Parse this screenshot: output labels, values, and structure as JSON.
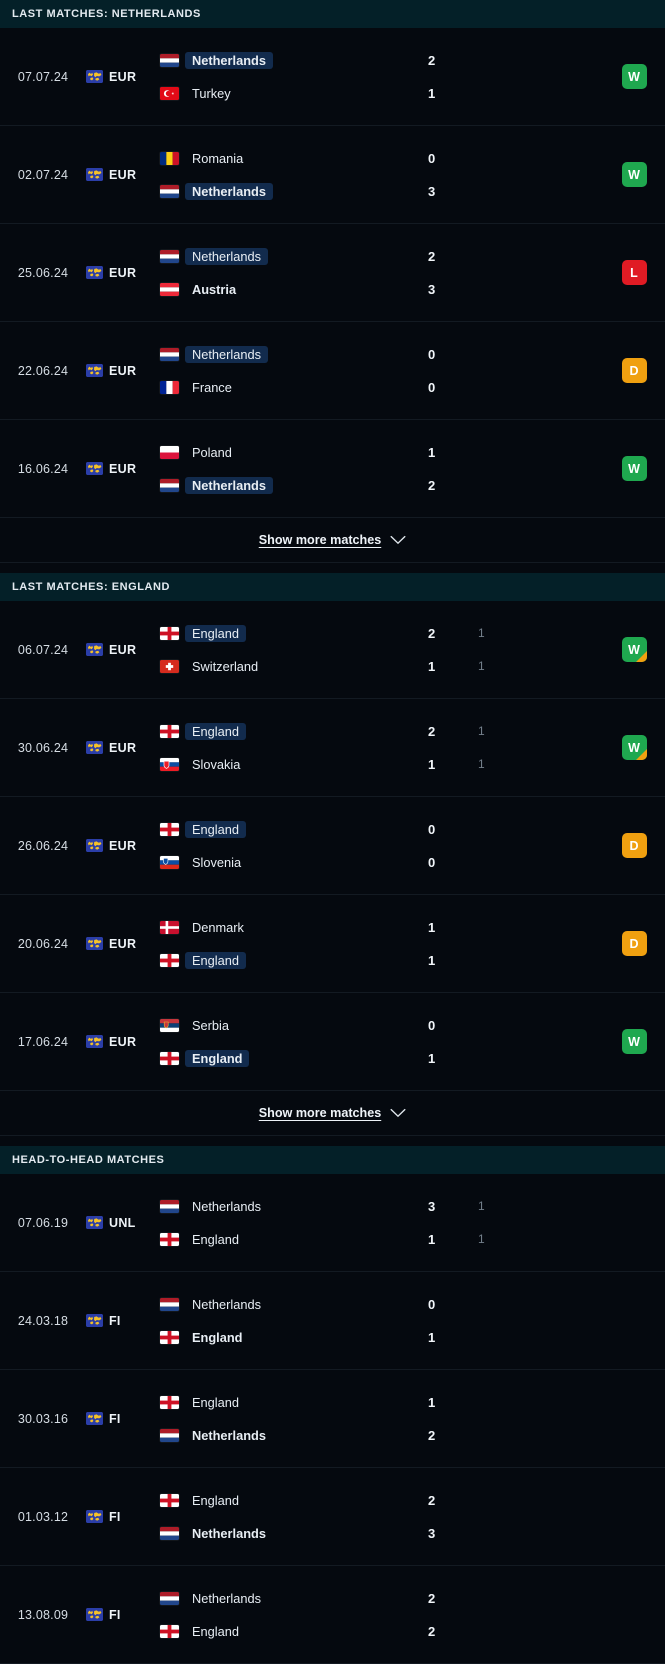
{
  "colors": {
    "page_bg": "#05090f",
    "section_header_bg": "#042028",
    "highlight_badge": "#122b4d",
    "win": "#1fa84f",
    "loss": "#e01b24",
    "draw": "#f0a010",
    "secondary_score": "#737f8b"
  },
  "sections": [
    {
      "id": "last-matches-netherlands",
      "title": "LAST MATCHES: NETHERLANDS",
      "show_more": {
        "label": "Show more matches",
        "icon": "chevron-down-icon"
      },
      "matches": [
        {
          "date": "07.07.24",
          "competition": "EUR",
          "competition_icon": "world-map-icon",
          "home": {
            "name": "Netherlands",
            "flag": "nl",
            "highlight": true,
            "bold": true
          },
          "away": {
            "name": "Turkey",
            "flag": "tr",
            "highlight": false,
            "bold": false
          },
          "score_home": "2",
          "score_away": "1",
          "sub_home": "",
          "sub_away": "",
          "result": "W",
          "result_corner": false
        },
        {
          "date": "02.07.24",
          "competition": "EUR",
          "competition_icon": "world-map-icon",
          "home": {
            "name": "Romania",
            "flag": "ro",
            "highlight": false,
            "bold": false
          },
          "away": {
            "name": "Netherlands",
            "flag": "nl",
            "highlight": true,
            "bold": true
          },
          "score_home": "0",
          "score_away": "3",
          "sub_home": "",
          "sub_away": "",
          "result": "W",
          "result_corner": false
        },
        {
          "date": "25.06.24",
          "competition": "EUR",
          "competition_icon": "world-map-icon",
          "home": {
            "name": "Netherlands",
            "flag": "nl",
            "highlight": true,
            "bold": false
          },
          "away": {
            "name": "Austria",
            "flag": "at",
            "highlight": false,
            "bold": true
          },
          "score_home": "2",
          "score_away": "3",
          "sub_home": "",
          "sub_away": "",
          "result": "L",
          "result_corner": false
        },
        {
          "date": "22.06.24",
          "competition": "EUR",
          "competition_icon": "world-map-icon",
          "home": {
            "name": "Netherlands",
            "flag": "nl",
            "highlight": true,
            "bold": false
          },
          "away": {
            "name": "France",
            "flag": "fr",
            "highlight": false,
            "bold": false
          },
          "score_home": "0",
          "score_away": "0",
          "sub_home": "",
          "sub_away": "",
          "result": "D",
          "result_corner": false
        },
        {
          "date": "16.06.24",
          "competition": "EUR",
          "competition_icon": "world-map-icon",
          "home": {
            "name": "Poland",
            "flag": "pl",
            "highlight": false,
            "bold": false
          },
          "away": {
            "name": "Netherlands",
            "flag": "nl",
            "highlight": true,
            "bold": true
          },
          "score_home": "1",
          "score_away": "2",
          "sub_home": "",
          "sub_away": "",
          "result": "W",
          "result_corner": false
        }
      ]
    },
    {
      "id": "last-matches-england",
      "title": "LAST MATCHES: ENGLAND",
      "show_more": {
        "label": "Show more matches",
        "icon": "chevron-down-icon"
      },
      "matches": [
        {
          "date": "06.07.24",
          "competition": "EUR",
          "competition_icon": "world-map-icon",
          "home": {
            "name": "England",
            "flag": "en",
            "highlight": true,
            "bold": false
          },
          "away": {
            "name": "Switzerland",
            "flag": "ch",
            "highlight": false,
            "bold": false
          },
          "score_home": "2",
          "score_away": "1",
          "sub_home": "1",
          "sub_away": "1",
          "result": "W",
          "result_corner": true
        },
        {
          "date": "30.06.24",
          "competition": "EUR",
          "competition_icon": "world-map-icon",
          "home": {
            "name": "England",
            "flag": "en",
            "highlight": true,
            "bold": false
          },
          "away": {
            "name": "Slovakia",
            "flag": "sk",
            "highlight": false,
            "bold": false
          },
          "score_home": "2",
          "score_away": "1",
          "sub_home": "1",
          "sub_away": "1",
          "result": "W",
          "result_corner": true
        },
        {
          "date": "26.06.24",
          "competition": "EUR",
          "competition_icon": "world-map-icon",
          "home": {
            "name": "England",
            "flag": "en",
            "highlight": true,
            "bold": false
          },
          "away": {
            "name": "Slovenia",
            "flag": "si",
            "highlight": false,
            "bold": false
          },
          "score_home": "0",
          "score_away": "0",
          "sub_home": "",
          "sub_away": "",
          "result": "D",
          "result_corner": false
        },
        {
          "date": "20.06.24",
          "competition": "EUR",
          "competition_icon": "world-map-icon",
          "home": {
            "name": "Denmark",
            "flag": "dk",
            "highlight": false,
            "bold": false
          },
          "away": {
            "name": "England",
            "flag": "en",
            "highlight": true,
            "bold": false
          },
          "score_home": "1",
          "score_away": "1",
          "sub_home": "",
          "sub_away": "",
          "result": "D",
          "result_corner": false
        },
        {
          "date": "17.06.24",
          "competition": "EUR",
          "competition_icon": "world-map-icon",
          "home": {
            "name": "Serbia",
            "flag": "rs",
            "highlight": false,
            "bold": false
          },
          "away": {
            "name": "England",
            "flag": "en",
            "highlight": true,
            "bold": true
          },
          "score_home": "0",
          "score_away": "1",
          "sub_home": "",
          "sub_away": "",
          "result": "W",
          "result_corner": false
        }
      ]
    },
    {
      "id": "head-to-head-matches",
      "title": "HEAD-TO-HEAD MATCHES",
      "show_more": null,
      "matches": [
        {
          "date": "07.06.19",
          "competition": "UNL",
          "competition_icon": "world-map-icon",
          "home": {
            "name": "Netherlands",
            "flag": "nl",
            "highlight": false,
            "bold": false
          },
          "away": {
            "name": "England",
            "flag": "en",
            "highlight": false,
            "bold": false
          },
          "score_home": "3",
          "score_away": "1",
          "sub_home": "1",
          "sub_away": "1",
          "result": "",
          "result_corner": false
        },
        {
          "date": "24.03.18",
          "competition": "FI",
          "competition_icon": "world-map-icon",
          "home": {
            "name": "Netherlands",
            "flag": "nl",
            "highlight": false,
            "bold": false
          },
          "away": {
            "name": "England",
            "flag": "en",
            "highlight": false,
            "bold": true
          },
          "score_home": "0",
          "score_away": "1",
          "sub_home": "",
          "sub_away": "",
          "result": "",
          "result_corner": false
        },
        {
          "date": "30.03.16",
          "competition": "FI",
          "competition_icon": "world-map-icon",
          "home": {
            "name": "England",
            "flag": "en",
            "highlight": false,
            "bold": false
          },
          "away": {
            "name": "Netherlands",
            "flag": "nl",
            "highlight": false,
            "bold": true
          },
          "score_home": "1",
          "score_away": "2",
          "sub_home": "",
          "sub_away": "",
          "result": "",
          "result_corner": false
        },
        {
          "date": "01.03.12",
          "competition": "FI",
          "competition_icon": "world-map-icon",
          "home": {
            "name": "England",
            "flag": "en",
            "highlight": false,
            "bold": false
          },
          "away": {
            "name": "Netherlands",
            "flag": "nl",
            "highlight": false,
            "bold": true
          },
          "score_home": "2",
          "score_away": "3",
          "sub_home": "",
          "sub_away": "",
          "result": "",
          "result_corner": false
        },
        {
          "date": "13.08.09",
          "competition": "FI",
          "competition_icon": "world-map-icon",
          "home": {
            "name": "Netherlands",
            "flag": "nl",
            "highlight": false,
            "bold": false
          },
          "away": {
            "name": "England",
            "flag": "en",
            "highlight": false,
            "bold": false
          },
          "score_home": "2",
          "score_away": "2",
          "sub_home": "",
          "sub_away": "",
          "result": "",
          "result_corner": false
        }
      ]
    }
  ]
}
